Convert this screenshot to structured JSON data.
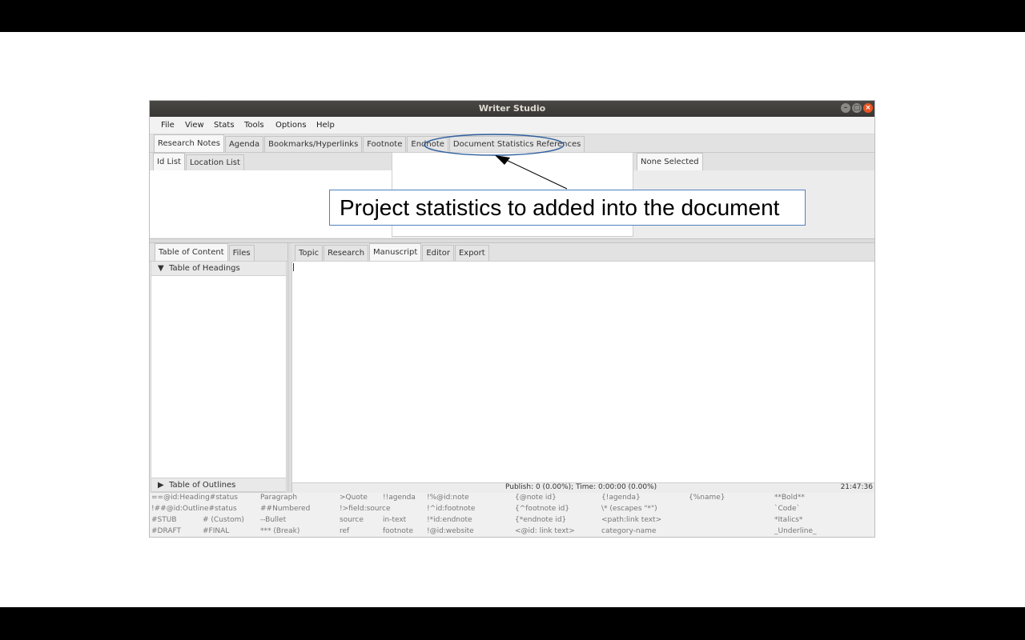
{
  "window": {
    "title": "Writer Studio"
  },
  "menu": [
    "File",
    "View",
    "Stats",
    "Tools",
    "Options",
    "Help"
  ],
  "top_tabs": [
    "Research Notes",
    "Agenda",
    "Bookmarks/Hyperlinks",
    "Footnote",
    "Endnote",
    "Document Statistics References"
  ],
  "left_subtabs": [
    "Id List",
    "Location List"
  ],
  "right_subtab": "None Selected",
  "sidebar_tabs": [
    "Table of Content",
    "Files"
  ],
  "tree": {
    "headings": "Table of Headings",
    "outlines": "Table of Outlines"
  },
  "editor_tabs": [
    "Topic",
    "Research",
    "Manuscript",
    "Editor",
    "Export"
  ],
  "status": {
    "publish": "Publish: 0 (0.00%); Time: 0:00:00 (0.00%)",
    "clock": "21:47:36"
  },
  "hints": [
    [
      "==@id:Heading#status",
      "Paragraph",
      ">Quote",
      "!!agenda",
      "!%@id:note",
      "{@note id}",
      "{!agenda}",
      "{%name}",
      "**Bold**"
    ],
    [
      "!##@id:Outline#status",
      "##Numbered",
      "!>field:source",
      "",
      "!^id:footnote",
      "{^footnote id}",
      "\\* (escapes \"*\")",
      "",
      "`Code`"
    ],
    [
      "#STUB",
      "# (Custom)",
      "--Bullet",
      "source",
      "in-text",
      "!*id:endnote",
      "{*endnote id}",
      "<path:link text>",
      "",
      "*Italics*"
    ],
    [
      "#DRAFT",
      "#FINAL",
      "*** (Break)",
      "ref",
      "footnote",
      "!@id:website",
      "<@id: link text>",
      "category-name",
      "",
      "_Underline_"
    ]
  ],
  "callout": {
    "text": "Project statistics to added into the document"
  },
  "colors": {
    "annotation": "#2f5f9e",
    "close_button": "#e95420"
  }
}
